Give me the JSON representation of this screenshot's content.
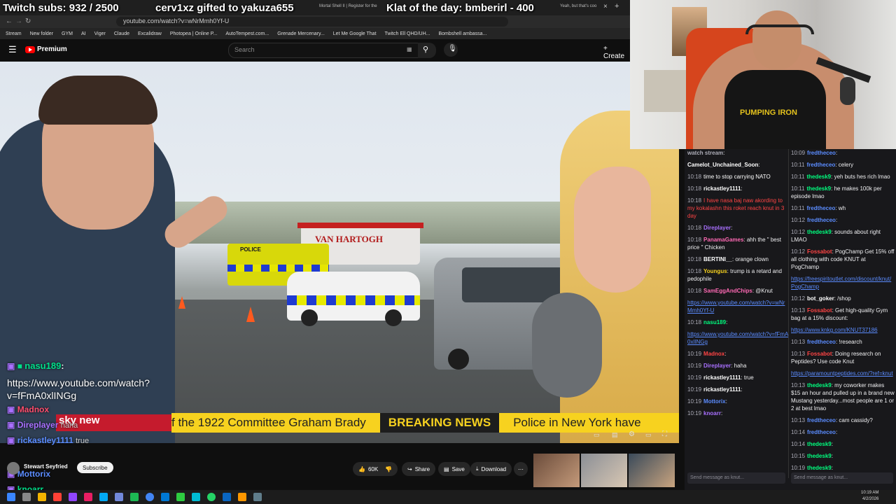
{
  "overlay": {
    "subs": "Twitch subs: 932 / 2500",
    "gifted": "cerv1xz gifted to yakuza655",
    "klat": "Klat of the day: bmberirl - 400"
  },
  "browser": {
    "tabs": [
      "Mortal Shell II | Register for the",
      "Yeah, but that's coo"
    ],
    "url": "youtube.com/watch?v=wNrMmh0Yf-U",
    "bookmarks": [
      "Stream",
      "New folder",
      "GYM",
      "AI",
      "Viger",
      "Claude",
      "Excalidraw",
      "Photopea | Online P...",
      "AutoTempest.com...",
      "Grenade Mercenary...",
      "Let Me Google That",
      "Twitch Ell QHD/UH...",
      "Bombshell ambassa..."
    ]
  },
  "youtube": {
    "brand": "Premium",
    "search_placeholder": "Search",
    "create_label": "Create",
    "likes": "60K",
    "share": "Share",
    "save": "Save",
    "download": "Download",
    "channel": "Stewart Seyfried",
    "subscribe": "Subscribe"
  },
  "ticker": {
    "left_text": "f the 1922 Committee Graham Brady",
    "breaking": "BREAKING NEWS",
    "right_text": "Police in New York have"
  },
  "scene": {
    "tanker_text": "VAN HARTOGH",
    "police_text": "POLICE"
  },
  "left_chat": {
    "user1": "nasu189",
    "url": "https://www.youtube.com/watch?v=fFmA0xlINGg",
    "user2": "Madnox",
    "user3": "Direplayer",
    "msg3": "haha",
    "user4": "rickastley1111",
    "msg4": "true",
    "user5": "Mottorix",
    "user6": "knoarr"
  },
  "chat_left_col": [
    {
      "ts": "",
      "user": "watch stream",
      "color": "#adadb8",
      "text": ""
    },
    {
      "ts": "",
      "user": "Camelot_Unchained_Soon",
      "color": "#ffffff",
      "text": ""
    },
    {
      "ts": "10:18",
      "user": "",
      "color": "#ffffff",
      "text": "time to stop carrying NATO"
    },
    {
      "ts": "10:18",
      "user": "rickastley1111",
      "color": "#ffffff",
      "text": ""
    },
    {
      "ts": "10:18",
      "user": "",
      "color": "#ff4444",
      "text": "I have nasa baj naw akording to my kokalashn this roket reach knut in 3 day"
    },
    {
      "ts": "10:18",
      "user": "Direplayer",
      "color": "#a970ff",
      "text": ""
    },
    {
      "ts": "10:18",
      "user": "PanamaGames",
      "color": "#ff69b4",
      "text": "ahh the \" best price \" Chicken"
    },
    {
      "ts": "10:18",
      "user": "BERTINI__",
      "color": "#ffffff",
      "text": "orange clown"
    },
    {
      "ts": "10:18",
      "user": "Youngus",
      "color": "#f7d21f",
      "text": "trump is a retard and pedophile"
    },
    {
      "ts": "10:18",
      "user": "SamEggAndChips",
      "color": "#ff69b4",
      "text": "@Knut"
    },
    {
      "ts": "",
      "user": "",
      "color": "#5b8cff",
      "text": "https://www.youtube.com/watch?v=wNrMmh0Yf-U"
    },
    {
      "ts": "10:18",
      "user": "nasu189",
      "color": "#00ff7f",
      "text": ""
    },
    {
      "ts": "",
      "user": "",
      "color": "#5b8cff",
      "text": "https://www.youtube.com/watch?v=fFmA0xlINGg"
    },
    {
      "ts": "10:19",
      "user": "Madnox",
      "color": "#ff4444",
      "text": ""
    },
    {
      "ts": "10:19",
      "user": "Direplayer",
      "color": "#a970ff",
      "text": "haha"
    },
    {
      "ts": "10:19",
      "user": "rickastley1111",
      "color": "#ffffff",
      "text": "true"
    },
    {
      "ts": "10:19",
      "user": "rickastley1111",
      "color": "#ffffff",
      "text": ""
    },
    {
      "ts": "10:19",
      "user": "Mottorix",
      "color": "#5b8cff",
      "text": ""
    },
    {
      "ts": "10:19",
      "user": "knoarr",
      "color": "#a970ff",
      "text": ""
    }
  ],
  "chat_right_col": [
    {
      "ts": "10:09",
      "user": "fredtheceo",
      "color": "#5b8cff",
      "text": ""
    },
    {
      "ts": "10:11",
      "user": "fredtheceo",
      "color": "#5b8cff",
      "text": "celery"
    },
    {
      "ts": "10:11",
      "user": "thedesk9",
      "color": "#00ff7f",
      "text": "yeh buts hes rich lmao"
    },
    {
      "ts": "10:11",
      "user": "thedesk9",
      "color": "#00ff7f",
      "text": "he makes 100k per episode lmao"
    },
    {
      "ts": "10:11",
      "user": "fredtheceo",
      "color": "#5b8cff",
      "text": "wh"
    },
    {
      "ts": "10:12",
      "user": "fredtheceo",
      "color": "#5b8cff",
      "text": ""
    },
    {
      "ts": "10:12",
      "user": "thedesk9",
      "color": "#00ff7f",
      "text": "sounds about right LMAO"
    },
    {
      "ts": "10:12",
      "user": "Fossabot",
      "color": "#ff4444",
      "text": "PogChamp Get 15% off all clothing with code KNUT at PogChamp"
    },
    {
      "ts": "",
      "user": "",
      "color": "#5b8cff",
      "text": "https://freespiritoutlet.com/discount/knut/ PogChamp"
    },
    {
      "ts": "10:12",
      "user": "bot_goker",
      "color": "#ffffff",
      "text": "/shop"
    },
    {
      "ts": "10:13",
      "user": "Fossabot",
      "color": "#ff4444",
      "text": "Get high-quality Gym bag at a 15% discount:"
    },
    {
      "ts": "",
      "user": "",
      "color": "#5b8cff",
      "text": "https://www.knkg.com/KNUT37186"
    },
    {
      "ts": "10:13",
      "user": "fredtheceo",
      "color": "#5b8cff",
      "text": "!research"
    },
    {
      "ts": "10:13",
      "user": "Fossabot",
      "color": "#ff4444",
      "text": "Doing research on Peptides? Use code Knut"
    },
    {
      "ts": "",
      "user": "",
      "color": "#5b8cff",
      "text": "https://paramountpeptides.com/?ref=knut"
    },
    {
      "ts": "10:13",
      "user": "thedesk9",
      "color": "#00ff7f",
      "text": "my coworker makes $15 an hour and pulled up in a brand new Mustang yesterday...most people are 1 or 2 at best lmao"
    },
    {
      "ts": "10:13",
      "user": "fredtheceo",
      "color": "#5b8cff",
      "text": "cam cassidy?"
    },
    {
      "ts": "10:14",
      "user": "fredtheceo",
      "color": "#5b8cff",
      "text": ""
    },
    {
      "ts": "10:14",
      "user": "thedesk9",
      "color": "#00ff7f",
      "text": ""
    },
    {
      "ts": "10:15",
      "user": "thedesk9",
      "color": "#00ff7f",
      "text": ""
    },
    {
      "ts": "10:19",
      "user": "thedesk9",
      "color": "#00ff7f",
      "text": ""
    }
  ],
  "chat_input": {
    "left_placeholder": "Send message as knut...",
    "right_placeholder": "Send message as knut..."
  },
  "webcam": {
    "shirt_text": "PUMPING IRON"
  },
  "taskbar": {
    "time": "10:19 AM",
    "date": "4/2/2026"
  }
}
